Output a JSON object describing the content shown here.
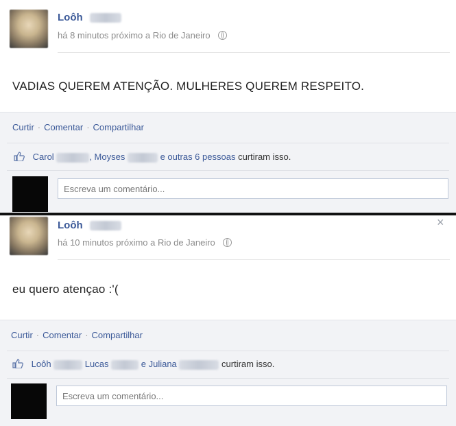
{
  "posts": [
    {
      "author": "Loôh",
      "time_location": "há 8 minutos próximo a Rio de Janeiro",
      "status": "VADIAS QUEREM ATENÇÃO. MULHERES QUEREM RESPEITO.",
      "actions": {
        "like": "Curtir",
        "comment": "Comentar",
        "share": "Compartilhar"
      },
      "likes": {
        "name1": "Carol",
        "name2": ", Moyses",
        "rest": "e outras 6 pessoas",
        "suffix": " curtiram isso."
      },
      "comment_placeholder": "Escreva um comentário..."
    },
    {
      "author": "Loôh",
      "time_location": "há 10 minutos próximo a Rio de Janeiro",
      "status": "eu quero atençao :'(",
      "actions": {
        "like": "Curtir",
        "comment": "Comentar",
        "share": "Compartilhar"
      },
      "likes": {
        "name1": "Loôh",
        "name2": "Lucas",
        "name3": "e Juliana",
        "suffix": "curtiram isso."
      },
      "comment_placeholder": "Escreva um comentário...",
      "close": "×"
    }
  ]
}
